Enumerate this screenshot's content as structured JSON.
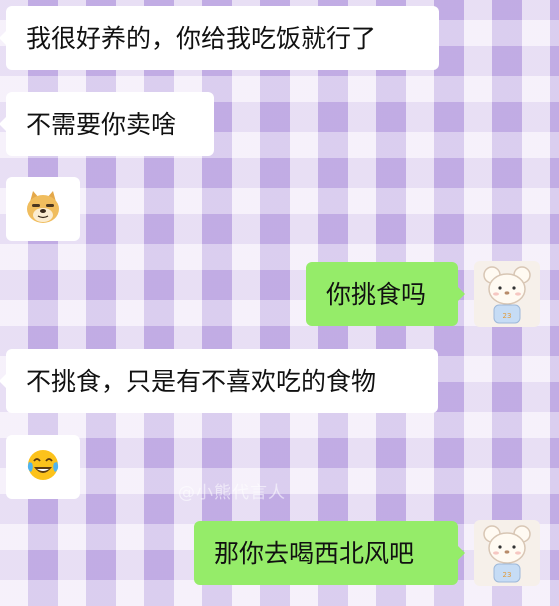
{
  "messages": [
    {
      "side": "in",
      "text": "我很好养的，你给我吃饭就行了"
    },
    {
      "side": "in",
      "text": "不需要你卖啥"
    },
    {
      "side": "in",
      "sticker": "doge-emoji-icon"
    },
    {
      "side": "out",
      "text": "你挑食吗"
    },
    {
      "side": "in",
      "text": "不挑食，只是有不喜欢吃的食物"
    },
    {
      "side": "in",
      "sticker": "tears-of-joy-emoji-icon"
    },
    {
      "side": "out",
      "text": "那你去喝西北风吧"
    }
  ],
  "watermark": "@小熊代言人",
  "colors": {
    "incoming_bubble": "#ffffff",
    "outgoing_bubble": "#95ec69",
    "background": "#d8c8ee"
  }
}
